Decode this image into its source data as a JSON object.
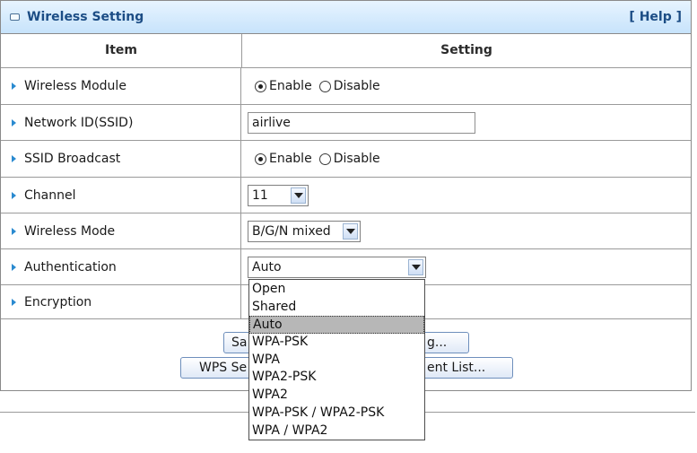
{
  "panel": {
    "title": "Wireless Setting",
    "help": "[ Help ]"
  },
  "columns": {
    "item": "Item",
    "setting": "Setting"
  },
  "rows": {
    "module": {
      "label": "Wireless Module",
      "opt1": "Enable",
      "opt2": "Disable",
      "selected": "Enable"
    },
    "ssid": {
      "label": "Network ID(SSID)",
      "value": "airlive"
    },
    "broadcast": {
      "label": "SSID Broadcast",
      "opt1": "Enable",
      "opt2": "Disable",
      "selected": "Enable"
    },
    "channel": {
      "label": "Channel",
      "value": "11"
    },
    "mode": {
      "label": "Wireless Mode",
      "value": "B/G/N mixed"
    },
    "auth": {
      "label": "Authentication",
      "value": "Auto"
    },
    "encryption": {
      "label": "Encryption"
    }
  },
  "buttons": {
    "save_left": "Sa",
    "advanced_right": "g...",
    "wps_left": "WPS Se",
    "client_right": "ent List..."
  },
  "auth_options": [
    "Open",
    "Shared",
    "Auto",
    "WPA-PSK",
    "WPA",
    "WPA2-PSK",
    "WPA2",
    "WPA-PSK / WPA2-PSK",
    "WPA / WPA2"
  ],
  "auth_selected_index": 2,
  "colors": {
    "header_text": "#1c4d85",
    "bullet": "#2a8ad0",
    "header_bg": "#c7e3fb"
  }
}
